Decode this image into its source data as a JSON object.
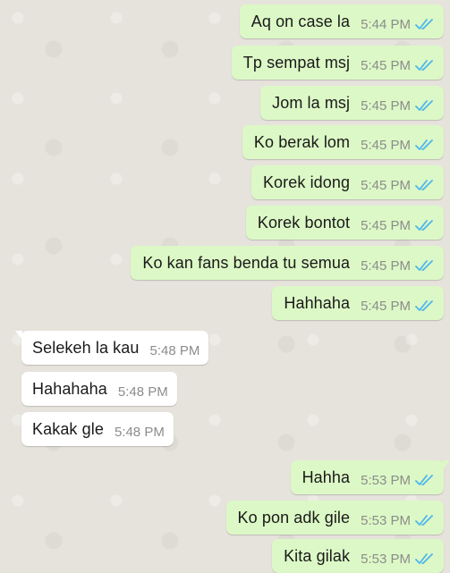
{
  "accent": {
    "tick_color": "#4fb6ec",
    "out_bubble": "#dcf8c6",
    "in_bubble": "#ffffff"
  },
  "messages": [
    {
      "direction": "out",
      "text": "Aq on case la",
      "time": "5:44 PM",
      "status": "read-icon"
    },
    {
      "direction": "out",
      "text": "Tp sempat msj",
      "time": "5:45 PM",
      "status": "read-icon"
    },
    {
      "direction": "out",
      "text": "Jom la msj",
      "time": "5:45 PM",
      "status": "read-icon"
    },
    {
      "direction": "out",
      "text": "Ko berak lom",
      "time": "5:45 PM",
      "status": "read-icon"
    },
    {
      "direction": "out",
      "text": "Korek idong",
      "time": "5:45 PM",
      "status": "read-icon"
    },
    {
      "direction": "out",
      "text": "Korek bontot",
      "time": "5:45 PM",
      "status": "read-icon"
    },
    {
      "direction": "out",
      "text": "Ko kan fans benda tu semua",
      "time": "5:45 PM",
      "status": "read-icon"
    },
    {
      "direction": "out",
      "text": "Hahhaha",
      "time": "5:45 PM",
      "status": "read-icon"
    },
    {
      "direction": "in",
      "text": "Selekeh la kau",
      "time": "5:48 PM"
    },
    {
      "direction": "in",
      "text": "Hahahaha",
      "time": "5:48 PM"
    },
    {
      "direction": "in",
      "text": "Kakak gle",
      "time": "5:48 PM"
    },
    {
      "direction": "out",
      "text": "Hahha",
      "time": "5:53 PM",
      "status": "read-icon"
    },
    {
      "direction": "out",
      "text": "Ko pon adk gile",
      "time": "5:53 PM",
      "status": "read-icon"
    },
    {
      "direction": "out",
      "text": "Kita gilak",
      "time": "5:53 PM",
      "status": "read-icon"
    }
  ]
}
